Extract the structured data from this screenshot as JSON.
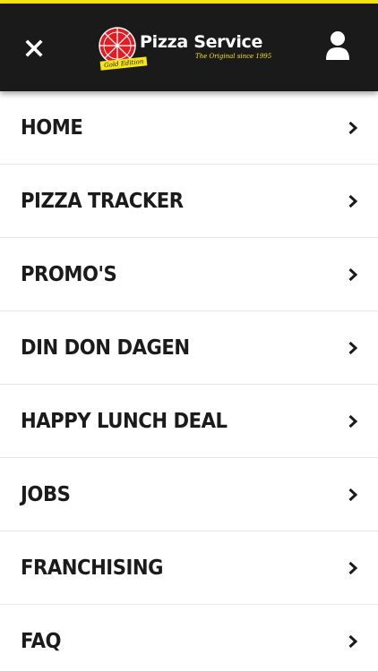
{
  "header": {
    "brand_name": "Pizza Service",
    "brand_tagline": "The Original since 1995",
    "badge_text": "Gold Edition",
    "close_icon": "close-icon",
    "user_icon": "user-icon",
    "colors": {
      "header_bg": "#1a1a1a",
      "accent": "#f6e418",
      "pizza_red": "#e31b23"
    }
  },
  "menu": {
    "items": [
      {
        "label": "HOME"
      },
      {
        "label": "PIZZA TRACKER"
      },
      {
        "label": "PROMO'S"
      },
      {
        "label": "DIN DON DAGEN"
      },
      {
        "label": "HAPPY LUNCH DEAL"
      },
      {
        "label": "JOBS"
      },
      {
        "label": "FRANCHISING"
      },
      {
        "label": "FAQ"
      }
    ],
    "chevron_icon": "chevron-right-icon"
  }
}
